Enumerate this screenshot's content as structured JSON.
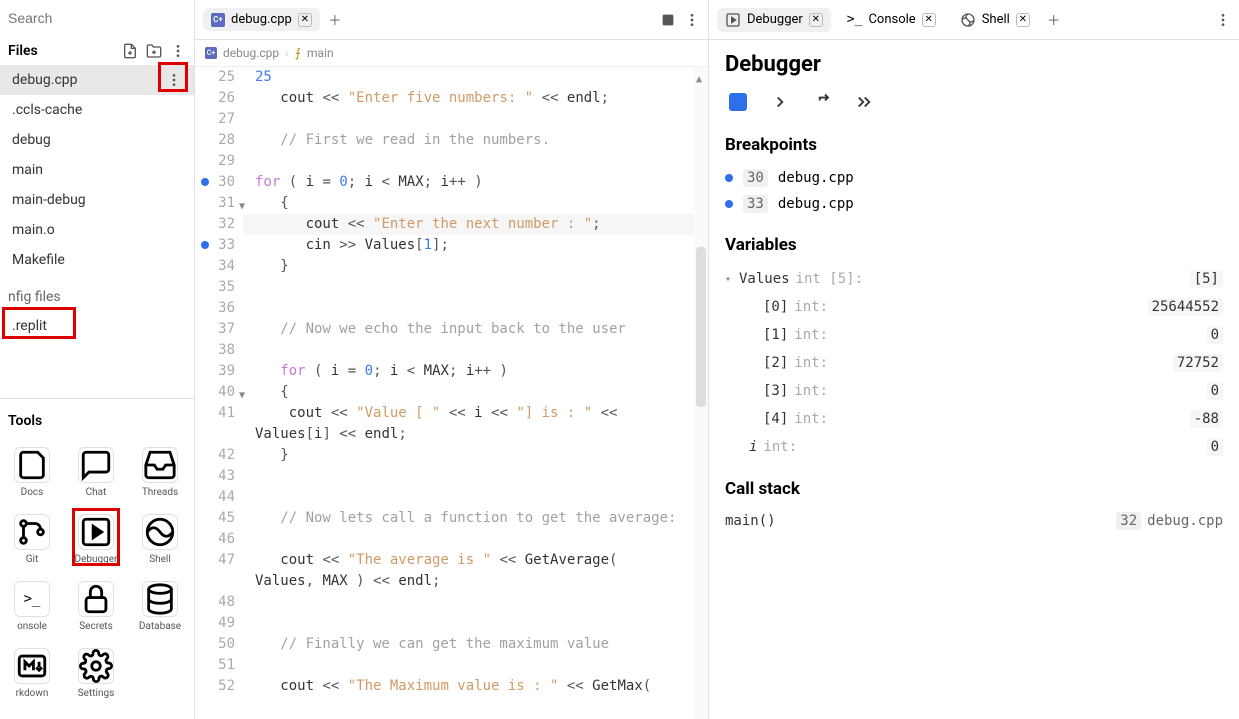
{
  "search": {
    "placeholder": "Search"
  },
  "files_header": "Files",
  "files": [
    {
      "name": "debug.cpp",
      "active": true
    },
    {
      "name": ".ccls-cache"
    },
    {
      "name": "debug"
    },
    {
      "name": "main"
    },
    {
      "name": "main-debug"
    },
    {
      "name": "main.o"
    },
    {
      "name": "Makefile"
    }
  ],
  "config_header": "nfig files",
  "config_files": [
    {
      "name": ".replit"
    }
  ],
  "tools_header": "Tools",
  "tools": [
    {
      "label": "Docs"
    },
    {
      "label": "Chat"
    },
    {
      "label": "Threads"
    },
    {
      "label": "Git"
    },
    {
      "label": "Debugger",
      "highlight": true
    },
    {
      "label": "Shell"
    },
    {
      "label": "onsole"
    },
    {
      "label": "Secrets"
    },
    {
      "label": "Database"
    },
    {
      "label": "rkdown"
    },
    {
      "label": "Settings"
    }
  ],
  "editor_tabs": [
    {
      "label": "debug.cpp",
      "active": true
    }
  ],
  "breadcrumb": {
    "file": "debug.cpp",
    "symbol": "main"
  },
  "code_start_line": 25,
  "code_current_line": 32,
  "code_breakpoints": [
    30,
    33
  ],
  "code_folds": [
    31,
    40
  ],
  "code_lines": [
    {
      "n": 25,
      "tok": [
        [
          "num",
          "25"
        ]
      ]
    },
    {
      "n": 26,
      "tok": [
        [
          "var",
          "   cout "
        ],
        [
          "punc",
          "<< "
        ],
        [
          "str",
          "\"Enter five numbers: \""
        ],
        [
          "punc",
          " << "
        ],
        [
          "var",
          "endl"
        ],
        [
          "punc",
          ";"
        ]
      ]
    },
    {
      "n": 27,
      "tok": []
    },
    {
      "n": 28,
      "tok": [
        [
          "cmt",
          "   // First we read in the numbers."
        ]
      ]
    },
    {
      "n": 29,
      "tok": []
    },
    {
      "n": 30,
      "tok": [
        [
          "kw",
          "for"
        ],
        [
          "punc",
          " ( "
        ],
        [
          "var",
          "i"
        ],
        [
          "punc",
          " = "
        ],
        [
          "num",
          "0"
        ],
        [
          "punc",
          "; "
        ],
        [
          "var",
          "i"
        ],
        [
          "punc",
          " < "
        ],
        [
          "var",
          "MAX"
        ],
        [
          "punc",
          "; "
        ],
        [
          "var",
          "i"
        ],
        [
          "punc",
          "++ )"
        ]
      ]
    },
    {
      "n": 31,
      "tok": [
        [
          "punc",
          "   {"
        ]
      ]
    },
    {
      "n": 32,
      "tok": [
        [
          "var",
          "      cout "
        ],
        [
          "punc",
          "<< "
        ],
        [
          "str",
          "\"Enter the next number : \""
        ],
        [
          "punc",
          ";"
        ]
      ]
    },
    {
      "n": 33,
      "tok": [
        [
          "var",
          "      cin "
        ],
        [
          "punc",
          ">> "
        ],
        [
          "var",
          "Values"
        ],
        [
          "punc",
          "["
        ],
        [
          "num",
          "1"
        ],
        [
          "punc",
          "];"
        ]
      ]
    },
    {
      "n": 34,
      "tok": [
        [
          "punc",
          "   }"
        ]
      ]
    },
    {
      "n": 35,
      "tok": []
    },
    {
      "n": 36,
      "tok": []
    },
    {
      "n": 37,
      "tok": [
        [
          "cmt",
          "   // Now we echo the input back to the user"
        ]
      ]
    },
    {
      "n": 38,
      "tok": []
    },
    {
      "n": 39,
      "tok": [
        [
          "var",
          "   "
        ],
        [
          "kw",
          "for"
        ],
        [
          "punc",
          " ( "
        ],
        [
          "var",
          "i"
        ],
        [
          "punc",
          " = "
        ],
        [
          "num",
          "0"
        ],
        [
          "punc",
          "; "
        ],
        [
          "var",
          "i"
        ],
        [
          "punc",
          " < "
        ],
        [
          "var",
          "MAX"
        ],
        [
          "punc",
          "; "
        ],
        [
          "var",
          "i"
        ],
        [
          "punc",
          "++ )"
        ]
      ]
    },
    {
      "n": 40,
      "tok": [
        [
          "punc",
          "   {"
        ]
      ]
    },
    {
      "n": 41,
      "tok": [
        [
          "var",
          "    cout "
        ],
        [
          "punc",
          "<< "
        ],
        [
          "str",
          "\"Value [ \""
        ],
        [
          "punc",
          " << "
        ],
        [
          "var",
          "i"
        ],
        [
          "punc",
          " << "
        ],
        [
          "str",
          "\"] is : \""
        ],
        [
          "punc",
          " << "
        ]
      ]
    },
    {
      "n": "",
      "tok": [
        [
          "var",
          "Values"
        ],
        [
          "punc",
          "["
        ],
        [
          "var",
          "i"
        ],
        [
          "punc",
          "] << "
        ],
        [
          "var",
          "endl"
        ],
        [
          "punc",
          ";"
        ]
      ]
    },
    {
      "n": 42,
      "tok": [
        [
          "punc",
          "   }"
        ]
      ]
    },
    {
      "n": 43,
      "tok": []
    },
    {
      "n": 44,
      "tok": []
    },
    {
      "n": 45,
      "tok": [
        [
          "cmt",
          "   // Now lets call a function to get the average:"
        ]
      ]
    },
    {
      "n": 46,
      "tok": []
    },
    {
      "n": 47,
      "tok": [
        [
          "var",
          "   cout "
        ],
        [
          "punc",
          "<< "
        ],
        [
          "str",
          "\"The average is \""
        ],
        [
          "punc",
          " << "
        ],
        [
          "var",
          "GetAverage"
        ],
        [
          "punc",
          "( "
        ]
      ]
    },
    {
      "n": "",
      "tok": [
        [
          "var",
          "Values"
        ],
        [
          "punc",
          ", "
        ],
        [
          "var",
          "MAX"
        ],
        [
          "punc",
          " ) << "
        ],
        [
          "var",
          "endl"
        ],
        [
          "punc",
          ";"
        ]
      ]
    },
    {
      "n": 48,
      "tok": []
    },
    {
      "n": 49,
      "tok": []
    },
    {
      "n": 50,
      "tok": [
        [
          "cmt",
          "   // Finally we can get the maximum value"
        ]
      ]
    },
    {
      "n": 51,
      "tok": []
    },
    {
      "n": 52,
      "tok": [
        [
          "var",
          "   cout "
        ],
        [
          "punc",
          "<< "
        ],
        [
          "str",
          "\"The Maximum value is : \""
        ],
        [
          "punc",
          " << "
        ],
        [
          "var",
          "GetMax"
        ],
        [
          "punc",
          "("
        ]
      ]
    }
  ],
  "debugger_tabs": [
    {
      "label": "Debugger",
      "active": true,
      "icon": "play-debug"
    },
    {
      "label": "Console",
      "icon": "terminal"
    },
    {
      "label": "Shell",
      "icon": "shell"
    }
  ],
  "debugger": {
    "title": "Debugger",
    "sections": {
      "breakpoints": "Breakpoints",
      "variables": "Variables",
      "callstack": "Call stack"
    },
    "breakpoints": [
      {
        "line": "30",
        "file": "debug.cpp"
      },
      {
        "line": "33",
        "file": "debug.cpp"
      }
    ],
    "variables": {
      "root": {
        "name": "Values",
        "type": "int [5]",
        "val": "[5]",
        "expanded": true
      },
      "children": [
        {
          "idx": "[0]",
          "type": "int",
          "val": "25644552"
        },
        {
          "idx": "[1]",
          "type": "int",
          "val": "0"
        },
        {
          "idx": "[2]",
          "type": "int",
          "val": "72752"
        },
        {
          "idx": "[3]",
          "type": "int",
          "val": "0"
        },
        {
          "idx": "[4]",
          "type": "int",
          "val": "-88"
        }
      ],
      "scalar": {
        "name": "i",
        "type": "int",
        "val": "0"
      }
    },
    "callstack": [
      {
        "func": "main()",
        "line": "32",
        "file": "debug.cpp"
      }
    ]
  }
}
